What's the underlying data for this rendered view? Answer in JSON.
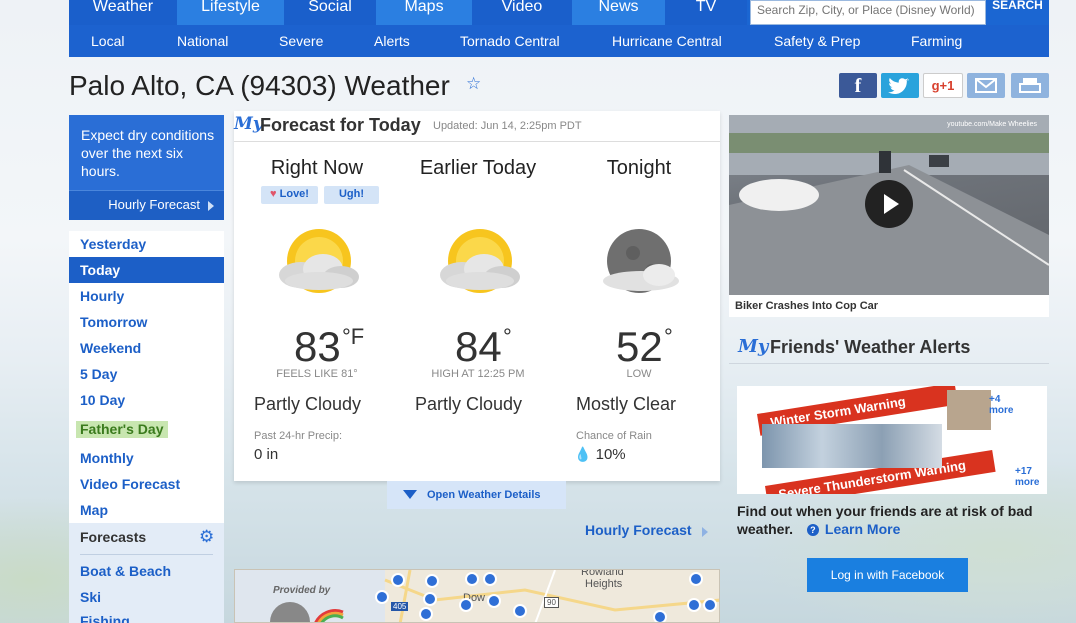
{
  "topnav": {
    "tabs": [
      "Weather",
      "Lifestyle",
      "Social",
      "Maps",
      "Video",
      "News",
      "TV"
    ],
    "search_placeholder": "Search Zip, City, or Place (Disney World)",
    "search_button": "SEARCH"
  },
  "subnav": [
    "Local",
    "National",
    "Severe",
    "Alerts",
    "Tornado Central",
    "Hurricane Central",
    "Safety & Prep",
    "Farming"
  ],
  "page": {
    "title": "Palo Alto, CA (94303) Weather",
    "star_icon": "favorite-star-icon"
  },
  "share": {
    "facebook": "f",
    "gplus": "g+1"
  },
  "alert": {
    "text": "Expect dry conditions over the next six hours.",
    "link": "Hourly Forecast"
  },
  "leftnav": {
    "items": [
      "Yesterday",
      "Today",
      "Hourly",
      "Tomorrow",
      "Weekend",
      "5 Day",
      "10 Day",
      "Father's Day",
      "Monthly",
      "Video Forecast",
      "Map"
    ],
    "active": "Today",
    "forecasts_header": "Forecasts",
    "forecast_items": [
      "Boat & Beach",
      "Ski",
      "Fishing"
    ]
  },
  "forecast": {
    "my_logo": "My",
    "title": "Forecast for Today",
    "updated": "Updated: Jun 14, 2:25pm PDT",
    "love": "Love!",
    "ugh": "Ugh!",
    "columns": [
      {
        "heading": "Right Now",
        "temp": "83",
        "unit": "°F",
        "sub": "FEELS LIKE 81°",
        "phrase": "Partly Cloudy",
        "label": "Past 24-hr Precip:",
        "value": "0 in",
        "icon": "partly-cloudy-icon"
      },
      {
        "heading": "Earlier Today",
        "temp": "84",
        "unit": "°",
        "sub": "HIGH AT 12:25 PM",
        "phrase": "Partly Cloudy",
        "label": "",
        "value": "",
        "icon": "partly-cloudy-icon"
      },
      {
        "heading": "Tonight",
        "temp": "52",
        "unit": "°",
        "sub": "LOW",
        "phrase": "Mostly Clear",
        "label": "Chance of Rain",
        "value": "10%",
        "icon": "mostly-clear-night-icon"
      }
    ],
    "open_details": "Open Weather Details",
    "hourly_link": "Hourly Forecast"
  },
  "map": {
    "provided_by": "Provided by",
    "towns": [
      "Rowland",
      "Heights",
      "Dow"
    ],
    "shields": [
      "405",
      "90"
    ]
  },
  "video": {
    "credit": "youtube.com/Make Wheelies",
    "caption": "Biker Crashes Into Cop Car"
  },
  "friends": {
    "my_logo": "My",
    "title": "Friends' Weather Alerts",
    "banner_1": "Winter Storm Warning",
    "banner_2": "Severe Thunderstorm Warning",
    "more_1": "+4 more",
    "more_2": "+17 more",
    "text": "Find out when your friends are at risk of bad weather.",
    "learn_more": "Learn More",
    "login_button": "Log in with Facebook"
  },
  "colors": {
    "brand_blue": "#1b66d2",
    "link_blue": "#1c5fc7",
    "facebook": "#3b5998",
    "twitter": "#2aa3dc",
    "gplus": "#d8402e"
  }
}
